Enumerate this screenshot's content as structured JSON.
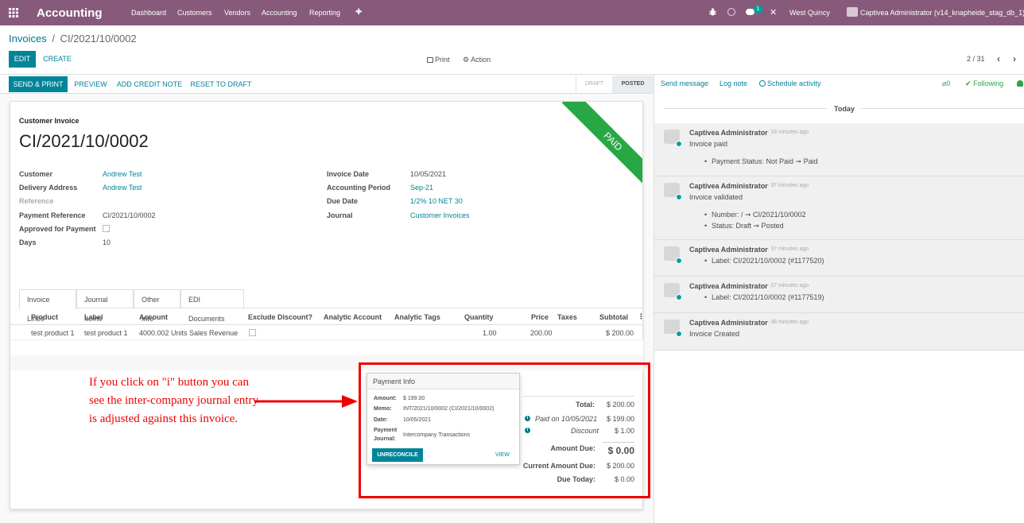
{
  "topbar": {
    "app_title": "Accounting",
    "menu": [
      "Dashboard",
      "Customers",
      "Vendors",
      "Accounting",
      "Reporting"
    ],
    "plus": "✚",
    "chat_badge": "1",
    "company": "West Quincy",
    "user": "Captivea Administrator (v14_knapheide_stag_db_1)"
  },
  "breadcrumb": {
    "parent": "Invoices",
    "sep": "/",
    "current": "CI/2021/10/0002"
  },
  "control": {
    "edit": "EDIT",
    "create": "CREATE",
    "print": "Print",
    "action": "Action",
    "pager": "2 / 31"
  },
  "statusbar": {
    "buttons": [
      "SEND & PRINT",
      "PREVIEW",
      "ADD CREDIT NOTE",
      "RESET TO DRAFT"
    ],
    "draft": "DRAFT",
    "posted": "POSTED"
  },
  "form": {
    "ribbon": "PAID",
    "subtitle": "Customer Invoice",
    "name": "CI/2021/10/0002",
    "left_fields": [
      {
        "label": "Customer",
        "value": "Andrew Test",
        "link": true
      },
      {
        "label": "Delivery Address",
        "value": "Andrew Test",
        "link": true
      },
      {
        "label": "Reference",
        "value": "",
        "link": false
      },
      {
        "label": "Payment Reference",
        "value": "CI/2021/10/0002",
        "link": false
      },
      {
        "label": "Approved for Payment",
        "value": "",
        "link": false
      },
      {
        "label": "Days",
        "value": "10",
        "link": false
      }
    ],
    "right_fields": [
      {
        "label": "Invoice Date",
        "value": "10/05/2021",
        "link": false
      },
      {
        "label": "Accounting Period",
        "value": "Sep-21",
        "link": true
      },
      {
        "label": "Due Date",
        "value": "1/2% 10 NET 30",
        "link": true
      },
      {
        "label": "Journal",
        "value": "Customer Invoices",
        "link": true
      }
    ],
    "tabs": [
      "Invoice Lines",
      "Journal Items",
      "Other Info",
      "EDI Documents"
    ],
    "columns": [
      "Product",
      "Label",
      "Account",
      "Exclude Discount?",
      "Analytic Account",
      "Analytic Tags",
      "Quantity",
      "Price",
      "Taxes",
      "Subtotal"
    ],
    "line": {
      "product": "test product 1",
      "label": "test product 1",
      "account": "4000.002 Units Sales Revenue",
      "quantity": "1.00",
      "price": "200.00",
      "subtotal": "$ 200.00"
    },
    "totals": {
      "total_label": "Total:",
      "total": "$ 200.00",
      "paid_label": "Paid on 10/05/2021",
      "paid": "$ 199.00",
      "discount_label": "Discount",
      "discount": "$ 1.00",
      "amount_due_label": "Amount Due:",
      "amount_due": "$ 0.00",
      "current_due_label": "Current Amount Due:",
      "current_due": "$ 200.00",
      "due_today_label": "Due Today:",
      "due_today": "$ 0.00"
    }
  },
  "payment_info": {
    "title": "Payment Info",
    "amount_label": "Amount:",
    "amount": "$ 199.00",
    "memo_label": "Memo:",
    "memo": "INT/2021/10/0002 (CI/2021/10/0002)",
    "date_label": "Date:",
    "date": "10/05/2021",
    "journal_label_1": "Payment",
    "journal_label_2": "Journal:",
    "journal": "Intercompany Transactions",
    "unreconcile": "UNRECONCILE",
    "view": "VIEW"
  },
  "annotation": {
    "text": "If you click on \"i\" button you can see the inter-company journal entry is adjusted against this invoice.",
    "color": "#e00000"
  },
  "chatter": {
    "send_message": "Send message",
    "log_note": "Log note",
    "schedule": "Schedule activity",
    "attachments": "0",
    "following": "Following",
    "today": "Today",
    "messages": [
      {
        "author": "Captivea Administrator",
        "time": "- 18 minutes ago",
        "body": "Invoice paid",
        "items": [
          "Payment Status: Not Paid ➞ Paid"
        ]
      },
      {
        "author": "Captivea Administrator",
        "time": "- 37 minutes ago",
        "body": "Invoice validated",
        "items": [
          "Number: / ➞ CI/2021/10/0002",
          "Status: Draft ➞ Posted"
        ]
      },
      {
        "author": "Captivea Administrator",
        "time": "- 37 minutes ago",
        "body": "",
        "items": [
          "Label:  CI/2021/10/0002 (#1177520)"
        ]
      },
      {
        "author": "Captivea Administrator",
        "time": "- 37 minutes ago",
        "body": "",
        "items": [
          "Label:  CI/2021/10/0002 (#1177519)"
        ]
      },
      {
        "author": "Captivea Administrator",
        "time": "- 38 minutes ago",
        "body": "Invoice Created",
        "items": []
      }
    ]
  },
  "colors": {
    "brand": "#875a7b",
    "accent": "#018599",
    "paid_ribbon": "#28a745",
    "highlight": "#e00000"
  }
}
